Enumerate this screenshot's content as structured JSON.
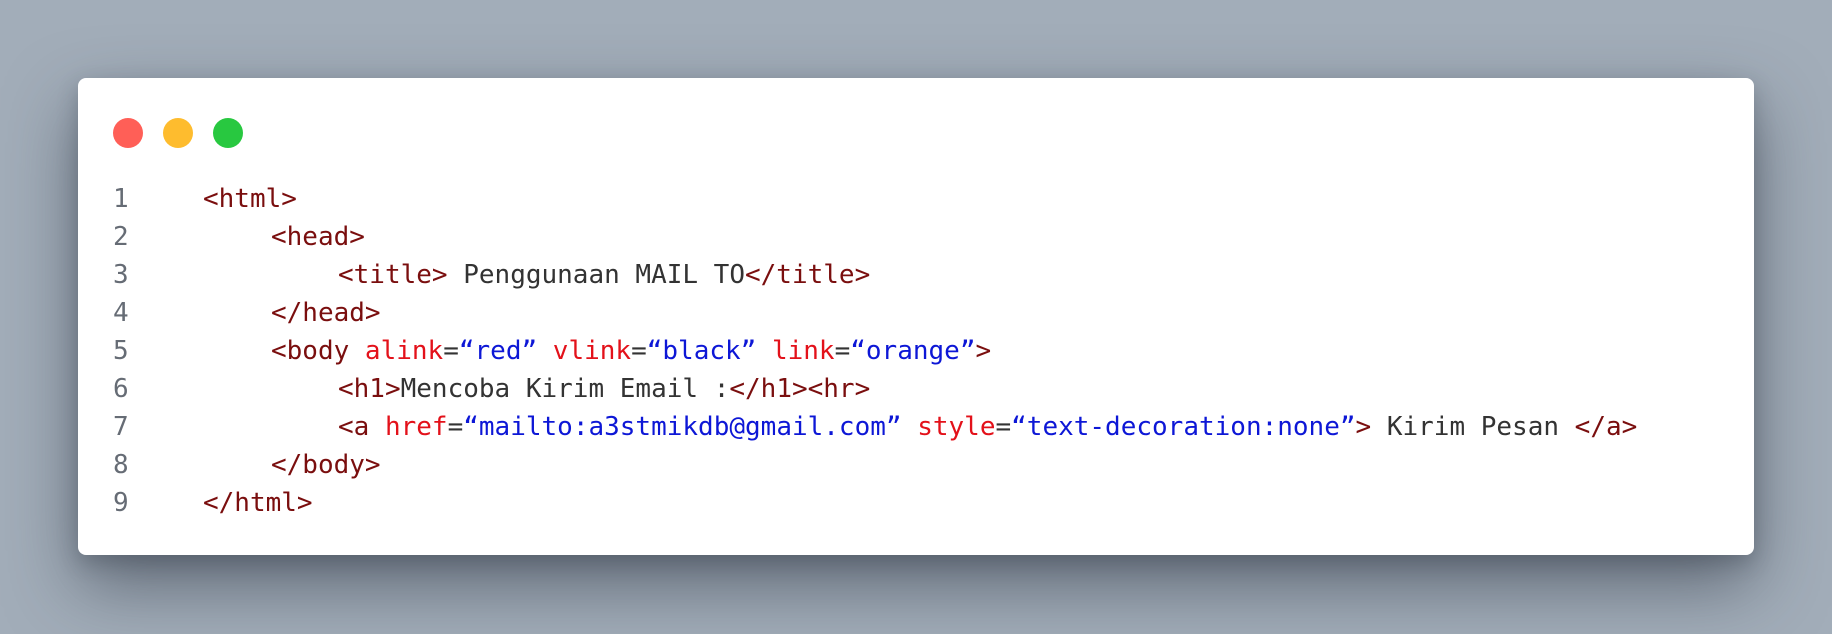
{
  "window": {
    "buttons": [
      {
        "name": "close",
        "color": "#ff5f57"
      },
      {
        "name": "minimize",
        "color": "#febc2e"
      },
      {
        "name": "maximize",
        "color": "#28c840"
      }
    ]
  },
  "colors": {
    "tag": "#7a0e0e",
    "attribute": "#e3111a",
    "string": "#0d17d6",
    "text": "#333333",
    "line_number": "#666c75"
  },
  "code": {
    "lines": [
      {
        "number": "1",
        "indent": 0,
        "tokens": [
          {
            "type": "tag",
            "text": "<html>"
          }
        ]
      },
      {
        "number": "2",
        "indent": 1,
        "tokens": [
          {
            "type": "tag",
            "text": "<head>"
          }
        ]
      },
      {
        "number": "3",
        "indent": 2,
        "tokens": [
          {
            "type": "tag",
            "text": "<title>"
          },
          {
            "type": "txt",
            "text": " Penggunaan MAIL TO"
          },
          {
            "type": "tag",
            "text": "</title>"
          }
        ]
      },
      {
        "number": "4",
        "indent": 1,
        "tokens": [
          {
            "type": "tag",
            "text": "</head>"
          }
        ]
      },
      {
        "number": "5",
        "indent": 1,
        "tokens": [
          {
            "type": "tag",
            "text": "<body "
          },
          {
            "type": "attr",
            "text": "alink"
          },
          {
            "type": "txt",
            "text": "="
          },
          {
            "type": "str",
            "text": "“red”"
          },
          {
            "type": "txt",
            "text": " "
          },
          {
            "type": "attr",
            "text": "vlink"
          },
          {
            "type": "txt",
            "text": "="
          },
          {
            "type": "str",
            "text": "“black”"
          },
          {
            "type": "txt",
            "text": " "
          },
          {
            "type": "attr",
            "text": "link"
          },
          {
            "type": "txt",
            "text": "="
          },
          {
            "type": "str",
            "text": "“orange”"
          },
          {
            "type": "tag",
            "text": ">"
          }
        ]
      },
      {
        "number": "6",
        "indent": 2,
        "tokens": [
          {
            "type": "tag",
            "text": "<h1>"
          },
          {
            "type": "txt",
            "text": "Mencoba Kirim Email :"
          },
          {
            "type": "tag",
            "text": "</h1><hr>"
          }
        ]
      },
      {
        "number": "7",
        "indent": 2,
        "tokens": [
          {
            "type": "tag",
            "text": "<a "
          },
          {
            "type": "attr",
            "text": "href"
          },
          {
            "type": "txt",
            "text": "="
          },
          {
            "type": "str",
            "text": "“mailto:a3stmikdb@gmail.com”"
          },
          {
            "type": "txt",
            "text": " "
          },
          {
            "type": "attr",
            "text": "style"
          },
          {
            "type": "txt",
            "text": "="
          },
          {
            "type": "str",
            "text": "“text-decoration:none”"
          },
          {
            "type": "tag",
            "text": ">"
          },
          {
            "type": "txt",
            "text": " Kirim Pesan "
          },
          {
            "type": "tag",
            "text": "</a>"
          }
        ]
      },
      {
        "number": "8",
        "indent": 1,
        "tokens": [
          {
            "type": "tag",
            "text": "</body>"
          }
        ]
      },
      {
        "number": "9",
        "indent": 0,
        "tokens": [
          {
            "type": "tag",
            "text": "</html>"
          }
        ]
      }
    ]
  }
}
